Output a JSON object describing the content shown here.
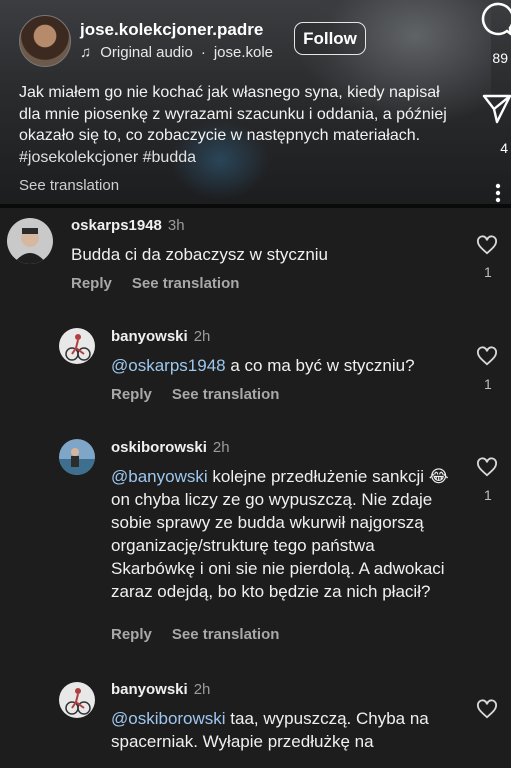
{
  "reel": {
    "username": "jose.kolekcjoner.padre",
    "audio": "Original audio",
    "audio_owner": "jose.kole",
    "follow_label": "Follow",
    "caption": "Jak miałem go nie kochać jak własnego syna, kiedy napisał dla mnie piosenkę z wyrazami szacunku i oddania, a później okazało się to, co zobaczycie w następnych materiałach.",
    "caption_tags": "#josekolekcjoner #budda",
    "see_translation": "See translation",
    "comment_count": "89",
    "share_count": "4",
    "icons": [
      "comment-icon",
      "share-icon",
      "more-icon",
      "music-note-icon"
    ]
  },
  "comments": [
    {
      "user": "oskarps1948",
      "time": "3h",
      "mention": "",
      "text": "Budda ci da zobaczysz w styczniu",
      "reply": "Reply",
      "translate": "See translation",
      "likes": "1"
    },
    {
      "user": "banyowski",
      "time": "2h",
      "mention": "@oskarps1948",
      "text": " a co ma być w styczniu?",
      "reply": "Reply",
      "translate": "See translation",
      "likes": "1"
    },
    {
      "user": "oskiborowski",
      "time": "2h",
      "mention": "@banyowski",
      "text": " kolejne przedłużenie sankcji 😂 on chyba liczy ze go wypuszczą. Nie zdaje sobie sprawy ze budda wkurwił najgorszą organizację/strukturę tego państwa Skarbówkę i oni sie nie pierdolą. A adwokaci zaraz odejdą, bo kto będzie za nich płacił?",
      "reply": "Reply",
      "translate": "See translation",
      "likes": "1"
    },
    {
      "user": "banyowski",
      "time": "2h",
      "mention": "@oskiborowski",
      "text": " taa, wypuszczą. Chyba na spacerniak. Wyłapie przedłużkę na",
      "reply": "",
      "translate": "",
      "likes": ""
    }
  ],
  "colors": {
    "mention": "#9ec7ef",
    "background": "#1d1d1d"
  }
}
